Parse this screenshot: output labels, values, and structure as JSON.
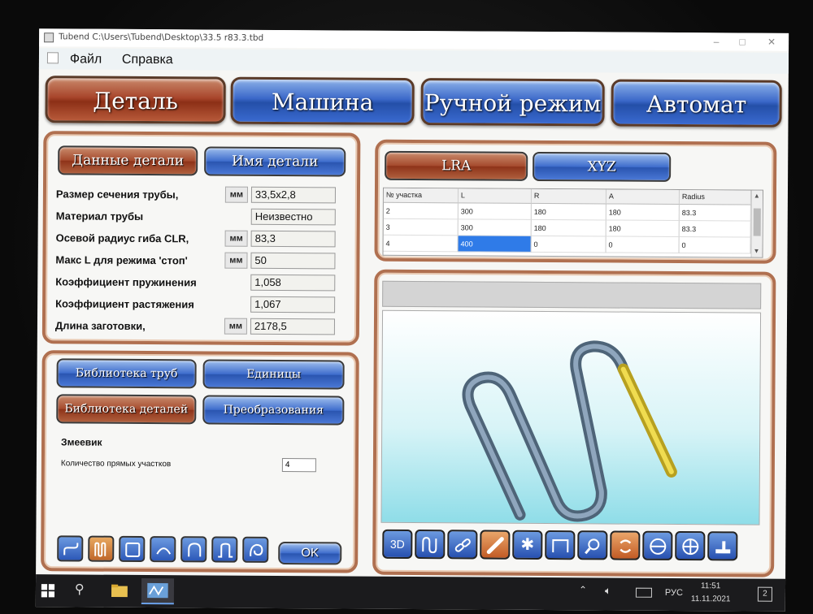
{
  "window": {
    "title": "Tubend C:\\Users\\Tubend\\Desktop\\33.5 r83.3.tbd",
    "minimize": "–",
    "maximize": "□",
    "close": "✕"
  },
  "menu": {
    "items": [
      "Файл",
      "Справка"
    ]
  },
  "main_tabs": [
    "Деталь",
    "Машина",
    "Ручной режим",
    "Автомат"
  ],
  "detail_panel": {
    "tabs": [
      "Данные детали",
      "Имя детали"
    ],
    "rows": [
      {
        "label": "Размер сечения трубы,",
        "unit": "мм",
        "value": "33,5x2,8"
      },
      {
        "label": "Материал трубы",
        "unit": "",
        "value": "Неизвестно"
      },
      {
        "label": "Осевой радиус гиба CLR,",
        "unit": "мм",
        "value": "83,3"
      },
      {
        "label": "Макс L для режима 'стоп'",
        "unit": "мм",
        "value": "50"
      },
      {
        "label": "Коэффициент пружинения",
        "unit": "",
        "value": "1,058"
      },
      {
        "label": "Коэффициент растяжения",
        "unit": "",
        "value": "1,067"
      },
      {
        "label": "Длина заготовки,",
        "unit": "мм",
        "value": "2178,5"
      }
    ]
  },
  "library_panel": {
    "buttons": [
      "Библиотека труб",
      "Единицы",
      "Библиотека деталей",
      "Преобразования"
    ],
    "shape_name": "Змеевик",
    "count_label": "Количество прямых участков",
    "count_value": "4",
    "ok_label": "OK",
    "shapes": [
      "offset-shape-icon",
      "serpentine-shape-icon",
      "rectangle-shape-icon",
      "arc-shape-icon",
      "u-shape-icon",
      "hairpin-shape-icon",
      "loop-shape-icon"
    ]
  },
  "coord_tabs": [
    "LRA",
    "XYZ"
  ],
  "table": {
    "headers": [
      "№ участка",
      "L",
      "R",
      "A",
      "Radius"
    ],
    "rows": [
      [
        "2",
        "300",
        "180",
        "180",
        "83.3"
      ],
      [
        "3",
        "300",
        "180",
        "180",
        "83.3"
      ],
      [
        "4",
        "400",
        "0",
        "0",
        "0"
      ]
    ]
  },
  "toolbar": {
    "tools": [
      "3d-view-icon",
      "bend-path-icon",
      "chain-icon",
      "pipe-icon",
      "star-icon",
      "frame-icon",
      "zoom-icon",
      "rotate-icon",
      "fit-vertical-icon",
      "fit-all-icon",
      "machine-icon"
    ],
    "view3d_label": "3D"
  },
  "taskbar": {
    "language": "РУС",
    "time": "11:51",
    "date": "11.11.2021",
    "notifications": "2"
  },
  "colors": {
    "active_tab": "#a8452b",
    "blue_tab": "#3b68c9",
    "panel_border": "#b07050",
    "pipe": "#6f86a0",
    "pipe_highlight": "#e6d040"
  }
}
